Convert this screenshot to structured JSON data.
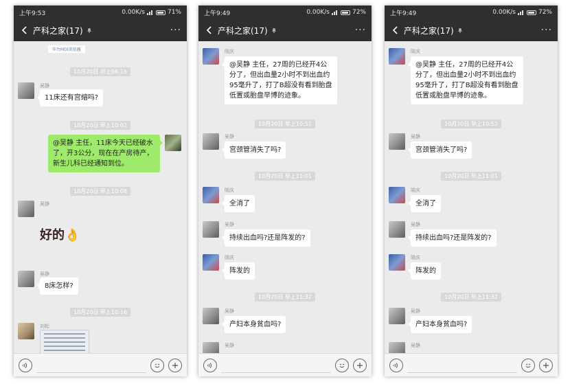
{
  "phones": [
    {
      "status": {
        "time": "上午9:53",
        "net": "0.00K/s",
        "battery": "71%"
      },
      "title": "产科之家(17)",
      "more": "···",
      "top_link": "华为MDI浏览器",
      "messages": [
        {
          "ts": "10月20日 早上06:16"
        },
        {
          "name": "吴静",
          "text": "11床还有宫缩吗?"
        },
        {
          "ts": "10月20日 早上10:02"
        },
        {
          "text": "@吴静  主任，11床今天已经破水了，开3公分，现在在产房待产，新生儿科已经通知到位。"
        },
        {
          "ts": "10月20日 早上10:08"
        },
        {
          "name": "吴静",
          "sticker": "好的👌"
        },
        {
          "name": "吴静",
          "text": "8床怎样?"
        },
        {
          "ts": "10月20日 早上10:16"
        },
        {
          "name": "刘松"
        }
      ]
    },
    {
      "status": {
        "time": "上午9:49",
        "net": "0.00K/s",
        "battery": "72%"
      },
      "title": "产科之家(17)",
      "more": "···",
      "messages": [
        {
          "name": "晓庆",
          "text": "@吴静  主任，27周的已经开4公分了，但出血量2小时不到出血约95毫升了，打了B超没有看到胎盘低置或胎盘早博的迹象。"
        },
        {
          "ts": "10月20日 早上10:52"
        },
        {
          "name": "吴静",
          "text": "宫颈管消失了吗?"
        },
        {
          "ts": "10月20日 早上11:01"
        },
        {
          "name": "晓庆",
          "text": "全消了"
        },
        {
          "name": "吴静",
          "text": "持续出血吗?还是阵发的?"
        },
        {
          "name": "晓庆",
          "text": "阵发的"
        },
        {
          "ts": "10月20日 早上11:32"
        },
        {
          "name": "吴静",
          "text": "产妇本身贫血吗?"
        },
        {
          "name": "吴静"
        }
      ]
    },
    {
      "status": {
        "time": "上午9:49",
        "net": "0.00K/s",
        "battery": "72%"
      },
      "title": "产科之家(17)",
      "more": "···",
      "messages": [
        {
          "name": "晓庆",
          "text": "@吴静  主任，27周的已经开4公分了，但出血量2小时不到出血约95毫升了，打了B超没有看到胎盘低置或胎盘早博的迹象。"
        },
        {
          "ts": "10月20日 早上10:52"
        },
        {
          "name": "吴静",
          "text": "宫颈管消失了吗?"
        },
        {
          "ts": "10月20日 早上11:01"
        },
        {
          "name": "晓庆",
          "text": "全消了"
        },
        {
          "name": "吴静",
          "text": "持续出血吗?还是阵发的?"
        },
        {
          "name": "晓庆",
          "text": "阵发的"
        },
        {
          "ts": "10月20日 早上11:32"
        },
        {
          "name": "吴静",
          "text": "产妇本身贫血吗?"
        },
        {
          "name": "吴静"
        }
      ]
    }
  ],
  "icons": {
    "back": "chevron-left-icon",
    "mute": "bell-off-icon",
    "voice": "voice-icon",
    "emoji": "emoji-icon",
    "plus": "plus-icon"
  },
  "colors": {
    "header": "#2f2f2f",
    "my_bubble": "#9eea6a",
    "chat_bg": "#ebebeb"
  }
}
